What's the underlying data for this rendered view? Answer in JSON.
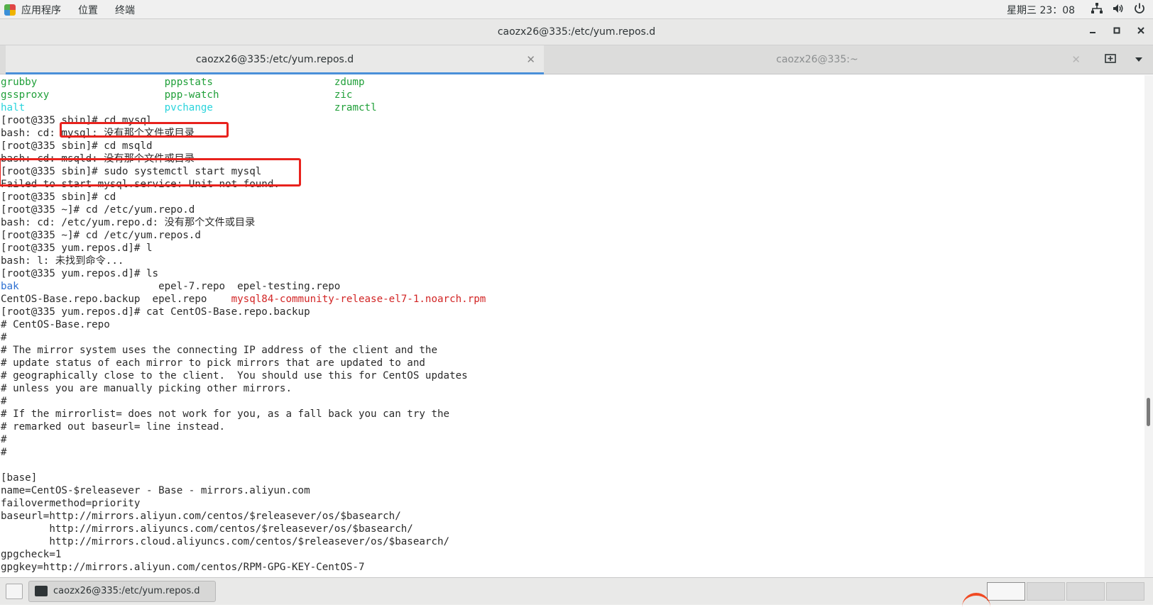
{
  "topbar": {
    "menus": [
      "应用程序",
      "位置",
      "终端"
    ],
    "clock": "星期三 23：08",
    "tray_icons": [
      "network-icon",
      "volume-icon",
      "power-icon"
    ]
  },
  "window": {
    "title": "caozx26@335:/etc/yum.repos.d",
    "controls": [
      "minimize",
      "maximize",
      "close"
    ]
  },
  "tabs": [
    {
      "label": "caozx26@335:/etc/yum.repos.d",
      "active": true
    },
    {
      "label": "caozx26@335:~",
      "active": false
    }
  ],
  "terminal": {
    "lines": [
      [
        {
          "t": "grubby",
          "c": "green"
        },
        {
          "t": "                     "
        },
        {
          "t": "pppstats",
          "c": "green"
        },
        {
          "t": "                    "
        },
        {
          "t": "zdump",
          "c": "green"
        }
      ],
      [
        {
          "t": "gssproxy",
          "c": "green"
        },
        {
          "t": "                   "
        },
        {
          "t": "ppp-watch",
          "c": "green"
        },
        {
          "t": "                   "
        },
        {
          "t": "zic",
          "c": "green"
        }
      ],
      [
        {
          "t": "halt",
          "c": "cyan"
        },
        {
          "t": "                       "
        },
        {
          "t": "pvchange",
          "c": "cyan"
        },
        {
          "t": "                    "
        },
        {
          "t": "zramctl",
          "c": "green"
        }
      ],
      [
        {
          "t": "[root@335 sbin]# cd mysql"
        }
      ],
      [
        {
          "t": "bash: cd: mysql: 没有那个文件或目录"
        }
      ],
      [
        {
          "t": "[root@335 sbin]# cd msqld"
        }
      ],
      [
        {
          "t": "bash: cd: msqld: 没有那个文件或目录"
        }
      ],
      [
        {
          "t": "[root@335 sbin]# sudo systemctl start mysql"
        }
      ],
      [
        {
          "t": "Failed to start mysql.service: Unit not found."
        }
      ],
      [
        {
          "t": "[root@335 sbin]# cd"
        }
      ],
      [
        {
          "t": "[root@335 ~]# cd /etc/yum.repo.d"
        }
      ],
      [
        {
          "t": "bash: cd: /etc/yum.repo.d: 没有那个文件或目录"
        }
      ],
      [
        {
          "t": "[root@335 ~]# cd /etc/yum.repos.d"
        }
      ],
      [
        {
          "t": "[root@335 yum.repos.d]# l"
        }
      ],
      [
        {
          "t": "bash: l: 未找到命令..."
        }
      ],
      [
        {
          "t": "[root@335 yum.repos.d]# ls"
        }
      ],
      [
        {
          "t": "bak",
          "c": "blue"
        },
        {
          "t": "                       epel-7.repo  epel-testing.repo"
        }
      ],
      [
        {
          "t": "CentOS-Base.repo.backup  epel.repo    "
        },
        {
          "t": "mysql84-community-release-el7-1.noarch.rpm",
          "c": "red"
        }
      ],
      [
        {
          "t": "[root@335 yum.repos.d]# cat CentOS-Base.repo.backup"
        }
      ],
      [
        {
          "t": "# CentOS-Base.repo"
        }
      ],
      [
        {
          "t": "#"
        }
      ],
      [
        {
          "t": "# The mirror system uses the connecting IP address of the client and the"
        }
      ],
      [
        {
          "t": "# update status of each mirror to pick mirrors that are updated to and"
        }
      ],
      [
        {
          "t": "# geographically close to the client.  You should use this for CentOS updates"
        }
      ],
      [
        {
          "t": "# unless you are manually picking other mirrors."
        }
      ],
      [
        {
          "t": "#"
        }
      ],
      [
        {
          "t": "# If the mirrorlist= does not work for you, as a fall back you can try the"
        }
      ],
      [
        {
          "t": "# remarked out baseurl= line instead."
        }
      ],
      [
        {
          "t": "#"
        }
      ],
      [
        {
          "t": "#"
        }
      ],
      [
        {
          "t": ""
        }
      ],
      [
        {
          "t": "[base]"
        }
      ],
      [
        {
          "t": "name=CentOS-$releasever - Base - mirrors.aliyun.com"
        }
      ],
      [
        {
          "t": "failovermethod=priority"
        }
      ],
      [
        {
          "t": "baseurl=http://mirrors.aliyun.com/centos/$releasever/os/$basearch/"
        }
      ],
      [
        {
          "t": "        http://mirrors.aliyuncs.com/centos/$releasever/os/$basearch/"
        }
      ],
      [
        {
          "t": "        http://mirrors.cloud.aliyuncs.com/centos/$releasever/os/$basearch/"
        }
      ],
      [
        {
          "t": "gpgcheck=1"
        }
      ],
      [
        {
          "t": "gpgkey=http://mirrors.aliyun.com/centos/RPM-GPG-KEY-CentOS-7"
        }
      ]
    ]
  },
  "taskbar": {
    "task_label": "caozx26@335:/etc/yum.repos.d",
    "workspaces": 4
  },
  "colors": {
    "accent": "#4a90d9",
    "highlight_box": "#e8221d",
    "green": "#21a03a",
    "cyan": "#2ad4dc",
    "blue": "#2c6fd1",
    "red": "#d22525"
  }
}
